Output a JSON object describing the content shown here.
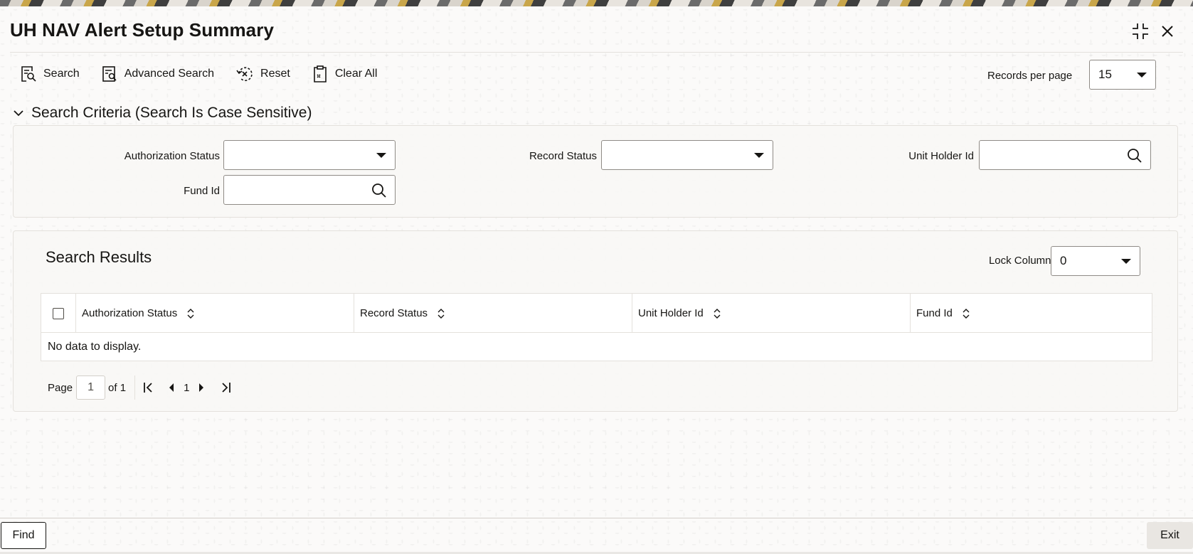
{
  "window": {
    "title": "UH NAV Alert Setup Summary",
    "controls": [
      "compress-icon",
      "close-icon"
    ]
  },
  "toolbar": {
    "search_label": "Search",
    "advanced_search_label": "Advanced Search",
    "reset_label": "Reset",
    "clear_all_label": "Clear All",
    "records_per_page_label": "Records per page",
    "records_per_page_value": "15"
  },
  "search_criteria": {
    "header": "Search Criteria (Search Is Case Sensitive)",
    "authorization_status_label": "Authorization Status",
    "authorization_status_value": "",
    "record_status_label": "Record Status",
    "record_status_value": "",
    "unit_holder_id_label": "Unit Holder Id",
    "unit_holder_id_value": "",
    "fund_id_label": "Fund Id",
    "fund_id_value": ""
  },
  "results": {
    "title": "Search Results",
    "lock_columns_label": "Lock Columns",
    "lock_columns_value": "0",
    "columns": [
      "Authorization Status",
      "Record Status",
      "Unit Holder Id",
      "Fund Id"
    ],
    "empty_message": "No data to display.",
    "pager": {
      "page_label": "Page",
      "current_page": "1",
      "of_label": "of 1",
      "page_number": "1"
    }
  },
  "footer": {
    "find_label": "Find",
    "exit_label": "Exit"
  },
  "colors": {
    "text": "#161513",
    "border": "#8f8b86",
    "divider": "#e4e1dc"
  }
}
